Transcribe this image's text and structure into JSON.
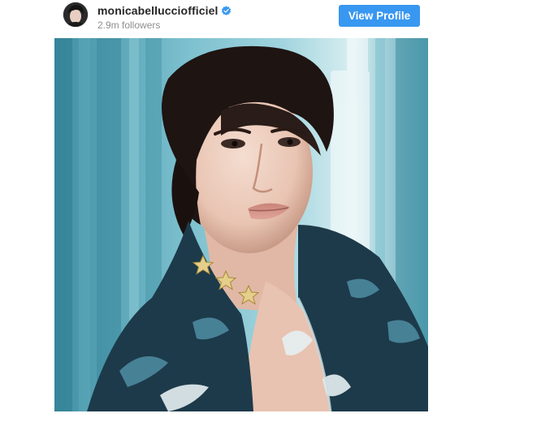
{
  "post": {
    "username": "monicabelluccіofficiel",
    "followers": "2.9m followers",
    "view_profile_label": "View Profile",
    "verified_icon": "verified-badge-icon",
    "photo_stars": 3
  },
  "colors": {
    "accent": "#3897f0",
    "username": "#262626",
    "muted": "#8e8e8e",
    "photo_background": "#4b9db0",
    "jacket": "#1d3a4a"
  }
}
